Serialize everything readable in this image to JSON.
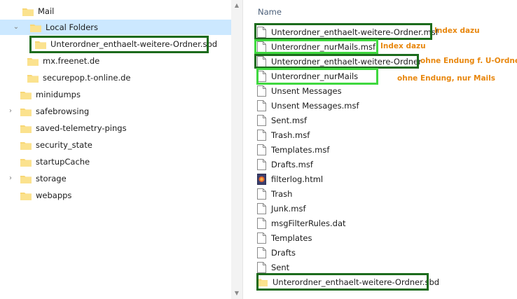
{
  "tree": {
    "items": [
      {
        "label": "Mail",
        "expanded": true
      },
      {
        "label": "Local Folders",
        "expanded": true,
        "selected": true
      },
      {
        "label": "Unterordner_enthaelt-weitere-Ordner.sbd"
      },
      {
        "label": "mx.freenet.de"
      },
      {
        "label": "securepop.t-online.de"
      },
      {
        "label": "minidumps"
      },
      {
        "label": "safebrowsing",
        "expandable": true
      },
      {
        "label": "saved-telemetry-pings"
      },
      {
        "label": "security_state"
      },
      {
        "label": "startupCache"
      },
      {
        "label": "storage",
        "expandable": true
      },
      {
        "label": "webapps"
      }
    ]
  },
  "file_list": {
    "column_header": "Name",
    "items": [
      {
        "label": "Unterordner_enthaelt-weitere-Ordner.msf",
        "icon": "file-icon"
      },
      {
        "label": "Unterordner_nurMails.msf",
        "icon": "file-icon"
      },
      {
        "label": "Unterordner_enthaelt-weitere-Ordner",
        "icon": "file-icon"
      },
      {
        "label": "Unterordner_nurMails",
        "icon": "file-icon"
      },
      {
        "label": "Unsent Messages",
        "icon": "file-icon"
      },
      {
        "label": "Unsent Messages.msf",
        "icon": "file-icon"
      },
      {
        "label": "Sent.msf",
        "icon": "file-icon"
      },
      {
        "label": "Trash.msf",
        "icon": "file-icon"
      },
      {
        "label": "Templates.msf",
        "icon": "file-icon"
      },
      {
        "label": "Drafts.msf",
        "icon": "file-icon"
      },
      {
        "label": "filterlog.html",
        "icon": "html-file-icon"
      },
      {
        "label": "Trash",
        "icon": "file-icon"
      },
      {
        "label": "Junk.msf",
        "icon": "file-icon"
      },
      {
        "label": "msgFilterRules.dat",
        "icon": "file-icon"
      },
      {
        "label": "Templates",
        "icon": "file-icon"
      },
      {
        "label": "Drafts",
        "icon": "file-icon"
      },
      {
        "label": "Sent",
        "icon": "file-icon"
      },
      {
        "label": "Unterordner_enthaelt-weitere-Ordner.sbd",
        "icon": "folder-icon"
      }
    ]
  },
  "annotations": {
    "index_dazu_1": "Index dazu",
    "index_dazu_2": "Index dazu",
    "ohne_endung_u_ordner": "ohne Endung f. U-Ordner",
    "ohne_endung_nur_mails": "ohne Endung, nur Mails"
  },
  "colors": {
    "selection": "#cce8ff",
    "folder": "#f8d775",
    "box_dark_green": "#1c6b1c",
    "box_light_green": "#3fd83f",
    "annotation_orange": "#e8870e",
    "header_text": "#4c607a"
  }
}
